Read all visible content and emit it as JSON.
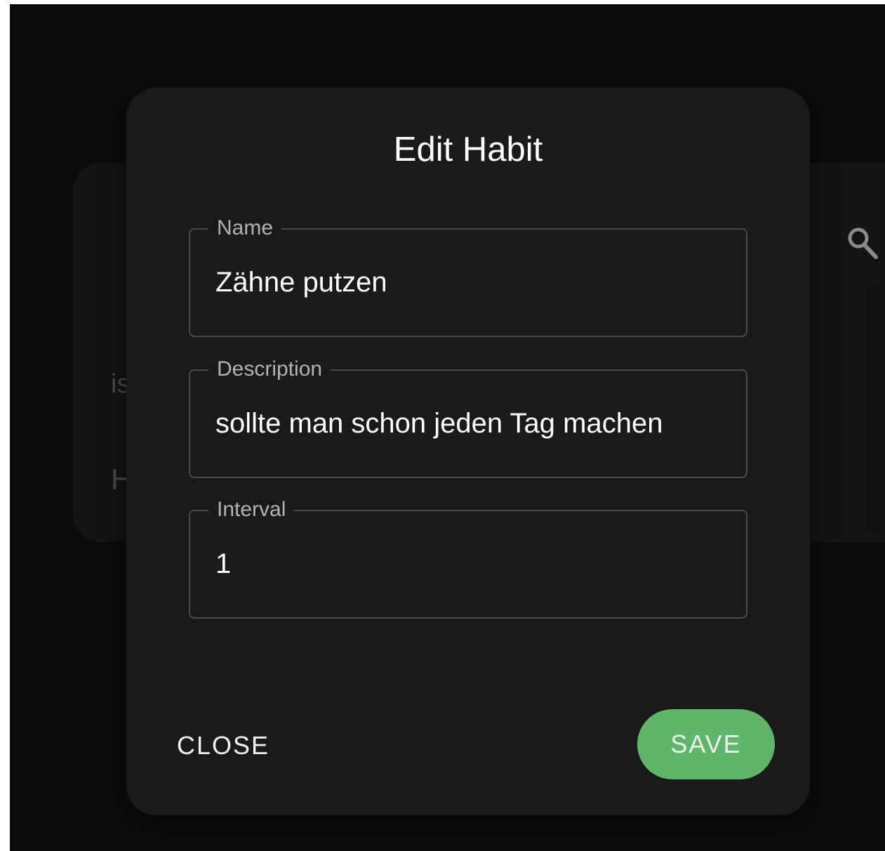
{
  "dialog": {
    "title": "Edit Habit"
  },
  "fields": {
    "name": {
      "label": "Name",
      "value": "Zähne putzen"
    },
    "description": {
      "label": "Description",
      "value": "sollte man schon jeden Tag machen"
    },
    "interval": {
      "label": "Interval",
      "value": "1"
    }
  },
  "actions": {
    "close_label": "CLOSE",
    "save_label": "SAVE"
  },
  "background": {
    "partial_text_1": "is",
    "partial_text_2": "H",
    "icon": "search-icon"
  },
  "colors": {
    "accent": "#5fb56a",
    "modal_bg": "#1a1a1a",
    "backdrop": "#0c0c0c"
  }
}
